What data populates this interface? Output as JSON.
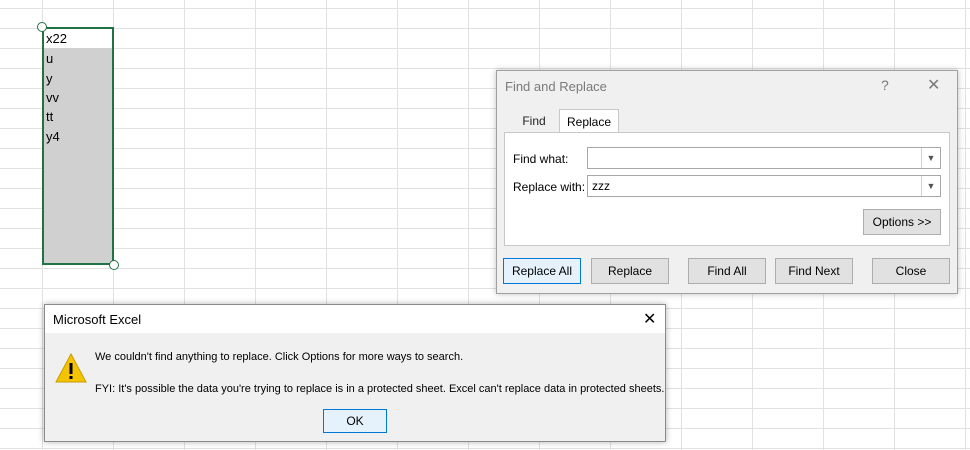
{
  "sheet": {
    "cells": [
      "x22",
      "u",
      "y",
      "vv",
      "tt",
      "y4"
    ]
  },
  "find_replace": {
    "title": "Find and Replace",
    "help": "?",
    "close": "✕",
    "tabs": [
      {
        "label": "Find"
      },
      {
        "label": "Replace"
      }
    ],
    "find_what_label": "Find what:",
    "find_what_value": "",
    "replace_with_label": "Replace with:",
    "replace_with_value": "zzz",
    "options_label": "Options >>",
    "buttons": {
      "replace_all": "Replace All",
      "replace": "Replace",
      "find_all": "Find All",
      "find_next": "Find Next",
      "close": "Close"
    }
  },
  "message_box": {
    "title": "Microsoft Excel",
    "close": "✕",
    "line1": "We couldn't find anything to replace. Click Options for more ways to search.",
    "line2": "FYI: It's possible the data you're trying to replace is in a protected sheet. Excel can't replace data in protected sheets.",
    "ok_label": "OK",
    "icon": "warning-icon"
  },
  "colors": {
    "selection_border": "#217346",
    "primary_button_border": "#0078d7",
    "warning_yellow": "#f5c400"
  }
}
